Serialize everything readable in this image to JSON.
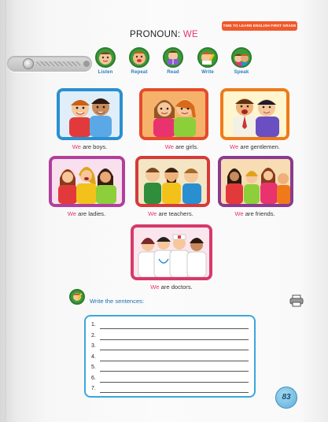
{
  "header": {
    "series_badge": "TIME TO LEARN ENGLISH FIRST GRADE",
    "title_prefix": "PRONOUN: ",
    "title_highlight": "WE"
  },
  "skills": [
    {
      "label": "Listen",
      "icon": "ear-icon"
    },
    {
      "label": "Repeat",
      "icon": "speaking-face-icon"
    },
    {
      "label": "Read",
      "icon": "book-icon"
    },
    {
      "label": "Write",
      "icon": "pencil-icon"
    },
    {
      "label": "Speak",
      "icon": "talking-kids-icon"
    }
  ],
  "pictures": [
    {
      "we": "We",
      "rest": " are boys."
    },
    {
      "we": "We",
      "rest": " are girls."
    },
    {
      "we": "We",
      "rest": " are gentlemen."
    },
    {
      "we": "We",
      "rest": " are ladies."
    },
    {
      "we": "We",
      "rest": " are teachers."
    },
    {
      "we": "We",
      "rest": " are friends."
    },
    {
      "we": "We",
      "rest": " are doctors."
    }
  ],
  "exercise": {
    "instruction": "Write the sentences:",
    "numbers": [
      "1.",
      "2.",
      "3.",
      "4.",
      "5.",
      "6.",
      "7."
    ]
  },
  "page_number": "83",
  "colors": {
    "pronoun": "#e8336f",
    "frame_blue": "#2a8fd0",
    "frame_orange": "#f07a1a",
    "frame_purple": "#b13f9c",
    "frame_red": "#d63a3a",
    "skill_green": "#3c9a3a"
  }
}
